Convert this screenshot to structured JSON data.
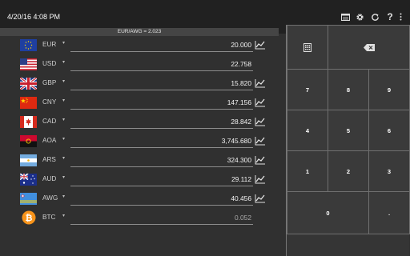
{
  "header": {
    "datetime": "4/20/16 4:08 PM",
    "actions": [
      {
        "name": "currency-list-icon"
      },
      {
        "name": "gear-icon"
      },
      {
        "name": "refresh-icon"
      },
      {
        "name": "help-icon"
      },
      {
        "name": "overflow-menu-icon"
      }
    ]
  },
  "rate_strip": "EUR/AWG = 2.023",
  "currencies": [
    {
      "code": "EUR",
      "value": "20.000",
      "flag": "eu"
    },
    {
      "code": "USD",
      "value": "22.758",
      "flag": "us"
    },
    {
      "code": "GBP",
      "value": "15.820",
      "flag": "gb"
    },
    {
      "code": "CNY",
      "value": "147.156",
      "flag": "cn"
    },
    {
      "code": "CAD",
      "value": "28.842",
      "flag": "ca"
    },
    {
      "code": "AOA",
      "value": "3,745.680",
      "flag": "ao"
    },
    {
      "code": "ARS",
      "value": "324.300",
      "flag": "ar"
    },
    {
      "code": "AUD",
      "value": "29.112",
      "flag": "au"
    },
    {
      "code": "AWG",
      "value": "40.456",
      "flag": "aw"
    },
    {
      "code": "BTC",
      "value": "0.052",
      "flag": "btc"
    }
  ],
  "keypad": {
    "calculator": "calculator-icon",
    "backspace": "backspace-icon",
    "k7": "7",
    "k8": "8",
    "k9": "9",
    "k4": "4",
    "k5": "5",
    "k6": "6",
    "k1": "1",
    "k2": "2",
    "k3": "3",
    "k0": "0",
    "dot": "."
  },
  "colors": {
    "background": "#303030",
    "topbar": "#212121",
    "keypad_border": "#6f6f6f"
  }
}
